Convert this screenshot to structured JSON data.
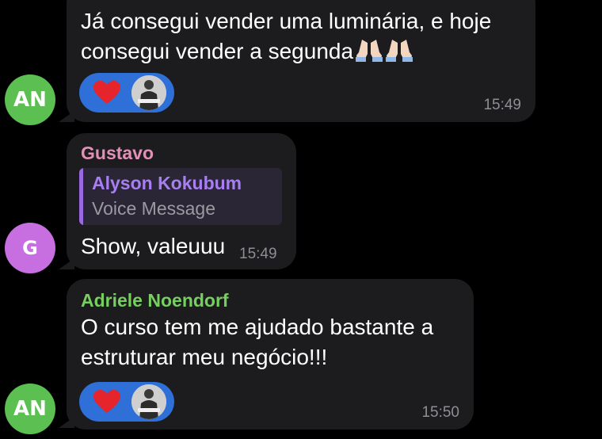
{
  "messages": [
    {
      "avatar_initials": "AN",
      "avatar_color": "#5cbf52",
      "text": "Já consegui vender uma luminária, e hoje\nconsegui vender a segunda",
      "emoji": "folded-hands-icon",
      "time": "15:49",
      "reaction": "heart-icon"
    },
    {
      "avatar_initials": "G",
      "avatar_color": "#c76ee0",
      "sender": "Gustavo",
      "sender_color": "#e38fb7",
      "reply_name": "Alyson Kokubum",
      "reply_text": "Voice Message",
      "text": "Show, valeuuu",
      "time": "15:49"
    },
    {
      "avatar_initials": "AN",
      "avatar_color": "#5cbf52",
      "sender": "Adriele Noendorf",
      "sender_color": "#76cf5e",
      "text": "O curso tem me ajudado bastante a\nestruturar meu negócio!!!",
      "time": "15:50",
      "reaction": "heart-icon"
    }
  ],
  "colors": {
    "background": "#000000",
    "bubble": "#1c1c1e",
    "reaction_pill": "#2e6fd8",
    "timestamp": "#8e8e93"
  }
}
